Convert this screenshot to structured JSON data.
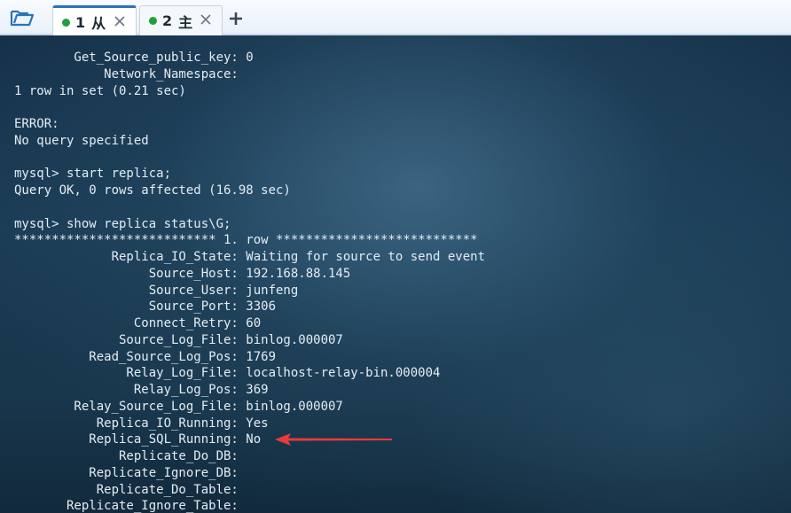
{
  "tabs": [
    {
      "number": "1",
      "title": "从",
      "active": true
    },
    {
      "number": "2",
      "title": "主",
      "active": false
    }
  ],
  "icons": {
    "folder": "folder-open-icon",
    "status_dot": "connected-dot-icon",
    "close": "close-icon",
    "new_tab": "plus-icon",
    "arrow": "red-arrow-annotation"
  },
  "colors": {
    "status_dot": "#1fa13a",
    "active_tab_accent": "#2a74b8",
    "arrow": "#e83c3c",
    "terminal_text": "#e4edf4"
  },
  "terminal": {
    "lines": [
      "        Get_Source_public_key: 0",
      "            Network_Namespace:",
      "1 row in set (0.21 sec)",
      "",
      "ERROR:",
      "No query specified",
      "",
      "mysql> start replica;",
      "Query OK, 0 rows affected (16.98 sec)",
      "",
      "mysql> show replica status\\G;",
      "*************************** 1. row ***************************",
      "             Replica_IO_State: Waiting for source to send event",
      "                  Source_Host: 192.168.88.145",
      "                  Source_User: junfeng",
      "                  Source_Port: 3306",
      "                Connect_Retry: 60",
      "              Source_Log_File: binlog.000007",
      "          Read_Source_Log_Pos: 1769",
      "               Relay_Log_File: localhost-relay-bin.000004",
      "                Relay_Log_Pos: 369",
      "        Relay_Source_Log_File: binlog.000007",
      "           Replica_IO_Running: Yes",
      "          Replica_SQL_Running: No",
      "              Replicate_Do_DB:",
      "          Replicate_Ignore_DB:",
      "           Replicate_Do_Table:",
      "       Replicate_Ignore_Table:"
    ]
  }
}
